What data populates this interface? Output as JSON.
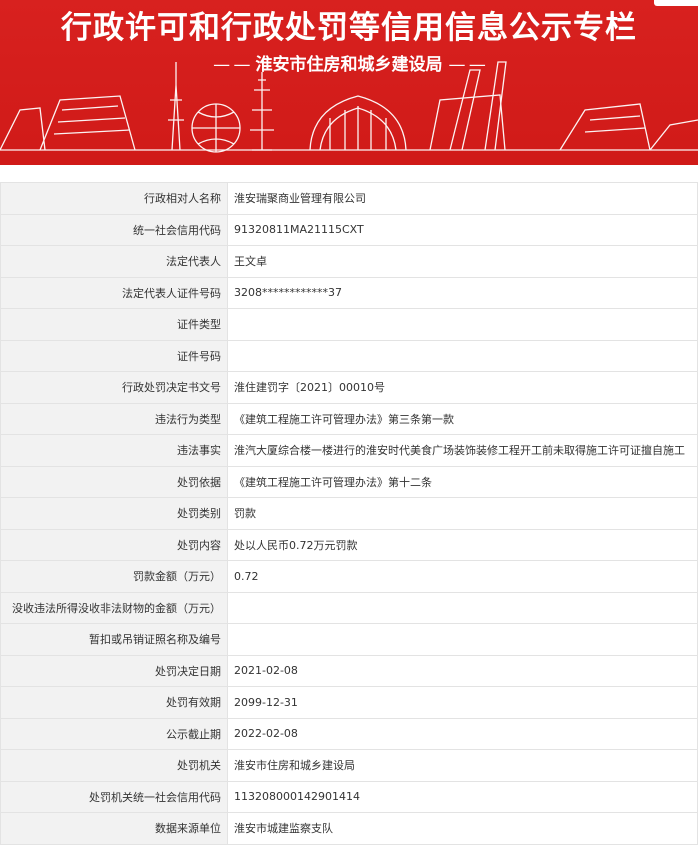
{
  "banner": {
    "title": "行政许可和行政处罚等信用信息公示专栏",
    "subtitle": "淮安市住房和城乡建设局",
    "dash_left": "— —",
    "dash_right": "— —",
    "background_color": "#d8211f"
  },
  "rows": [
    {
      "label": "行政相对人名称",
      "value": "淮安瑞聚商业管理有限公司"
    },
    {
      "label": "统一社会信用代码",
      "value": "91320811MA21115CXT"
    },
    {
      "label": "法定代表人",
      "value": "王文卓"
    },
    {
      "label": "法定代表人证件号码",
      "value": "3208************37"
    },
    {
      "label": "证件类型",
      "value": ""
    },
    {
      "label": "证件号码",
      "value": ""
    },
    {
      "label": "行政处罚决定书文号",
      "value": "淮住建罚字〔2021〕00010号"
    },
    {
      "label": "违法行为类型",
      "value": "《建筑工程施工许可管理办法》第三条第一款"
    },
    {
      "label": "违法事实",
      "value": "淮汽大厦综合楼一楼进行的淮安时代美食广场装饰装修工程开工前未取得施工许可证擅自施工"
    },
    {
      "label": "处罚依据",
      "value": "《建筑工程施工许可管理办法》第十二条"
    },
    {
      "label": "处罚类别",
      "value": "罚款"
    },
    {
      "label": "处罚内容",
      "value": "处以人民币0.72万元罚款"
    },
    {
      "label": "罚款金额（万元）",
      "value": "0.72"
    },
    {
      "label": "没收违法所得没收非法财物的金额（万元）",
      "value": ""
    },
    {
      "label": "暂扣或吊销证照名称及编号",
      "value": ""
    },
    {
      "label": "处罚决定日期",
      "value": "2021-02-08"
    },
    {
      "label": "处罚有效期",
      "value": "2099-12-31"
    },
    {
      "label": "公示截止期",
      "value": "2022-02-08"
    },
    {
      "label": "处罚机关",
      "value": "淮安市住房和城乡建设局"
    },
    {
      "label": "处罚机关统一社会信用代码",
      "value": "113208000142901414"
    },
    {
      "label": "数据来源单位",
      "value": "淮安市城建监察支队"
    }
  ]
}
